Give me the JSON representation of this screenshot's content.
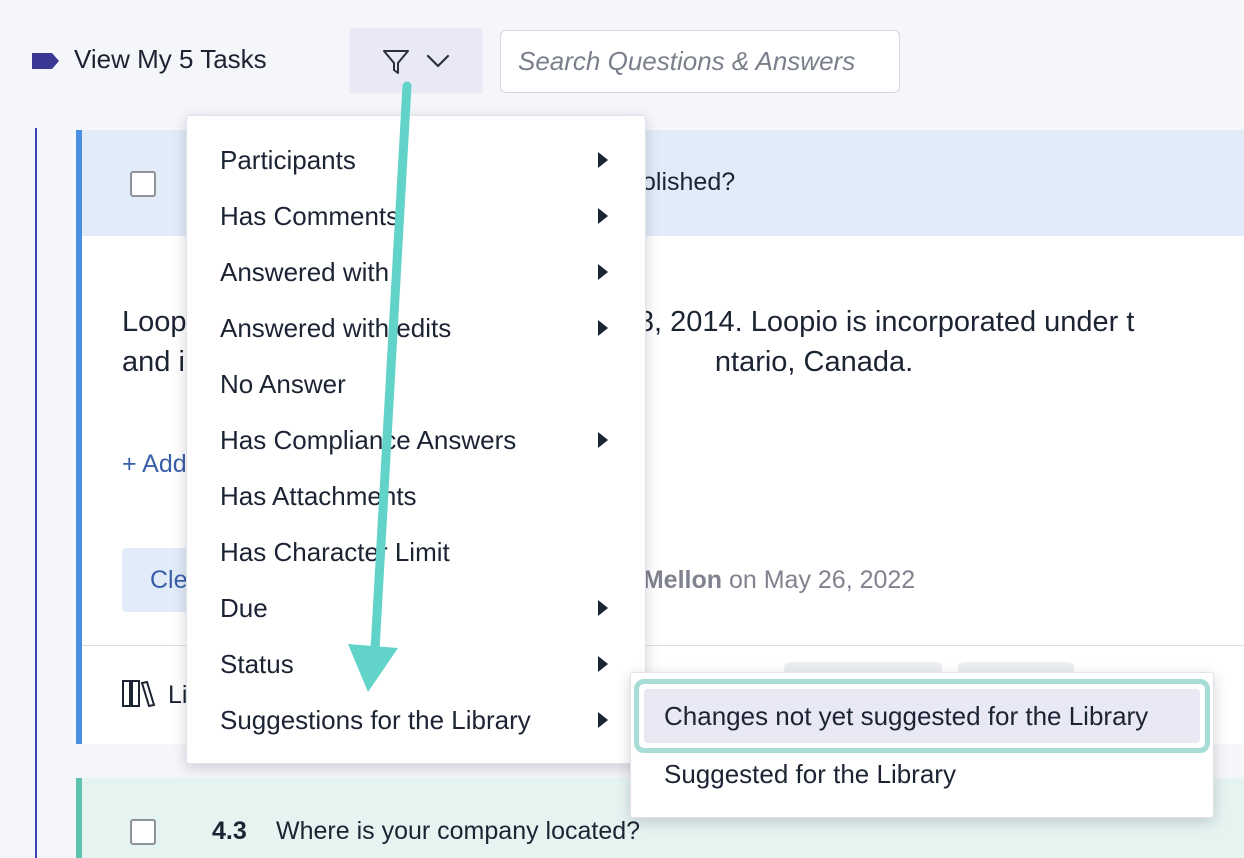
{
  "topbar": {
    "view_tasks_label": "View My 5 Tasks",
    "search_placeholder": "Search Questions & Answers",
    "tag_color": "#3a3795"
  },
  "question_card_1": {
    "question_fragment": "olished?",
    "answer_line_1": "Loop",
    "answer_line_1_right": "ry 18, 2014. Loopio is incorporated under t",
    "answer_line_2": "and i",
    "answer_line_2_right": "ntario, Canada.",
    "add_link_label": "+ Add",
    "clear_button_label": "Cle",
    "meta_author": "e Mellon",
    "meta_on": "on May 26, 2022",
    "library_label": "Li",
    "accent_color": "#4a90e2"
  },
  "question_card_2": {
    "number": "4.3",
    "text": "Where is your company located?",
    "accent_color": "#5ec2b0"
  },
  "filter_menu": {
    "items": [
      {
        "label": "Participants",
        "has_submenu": true
      },
      {
        "label": "Has Comments",
        "has_submenu": true
      },
      {
        "label": "Answered with",
        "has_submenu": true
      },
      {
        "label": "Answered with edits",
        "has_submenu": true
      },
      {
        "label": "No Answer",
        "has_submenu": false
      },
      {
        "label": "Has Compliance Answers",
        "has_submenu": true
      },
      {
        "label": "Has Attachments",
        "has_submenu": false
      },
      {
        "label": "Has Character Limit",
        "has_submenu": false
      },
      {
        "label": "Due",
        "has_submenu": true
      },
      {
        "label": "Status",
        "has_submenu": true
      },
      {
        "label": "Suggestions for the Library",
        "has_submenu": true
      }
    ]
  },
  "submenu": {
    "items": [
      {
        "label": "Changes not yet suggested for the Library",
        "selected": true
      },
      {
        "label": "Suggested for the Library",
        "selected": false
      }
    ],
    "highlight_color": "#a8dcd6"
  },
  "annotation": {
    "arrow_color": "#62d3c8"
  },
  "icons": {
    "tag": "tag-icon",
    "filter": "funnel-icon",
    "dropdown": "chevron-down-icon",
    "library": "books-icon",
    "submenu_indicator": "caret-right-icon"
  }
}
